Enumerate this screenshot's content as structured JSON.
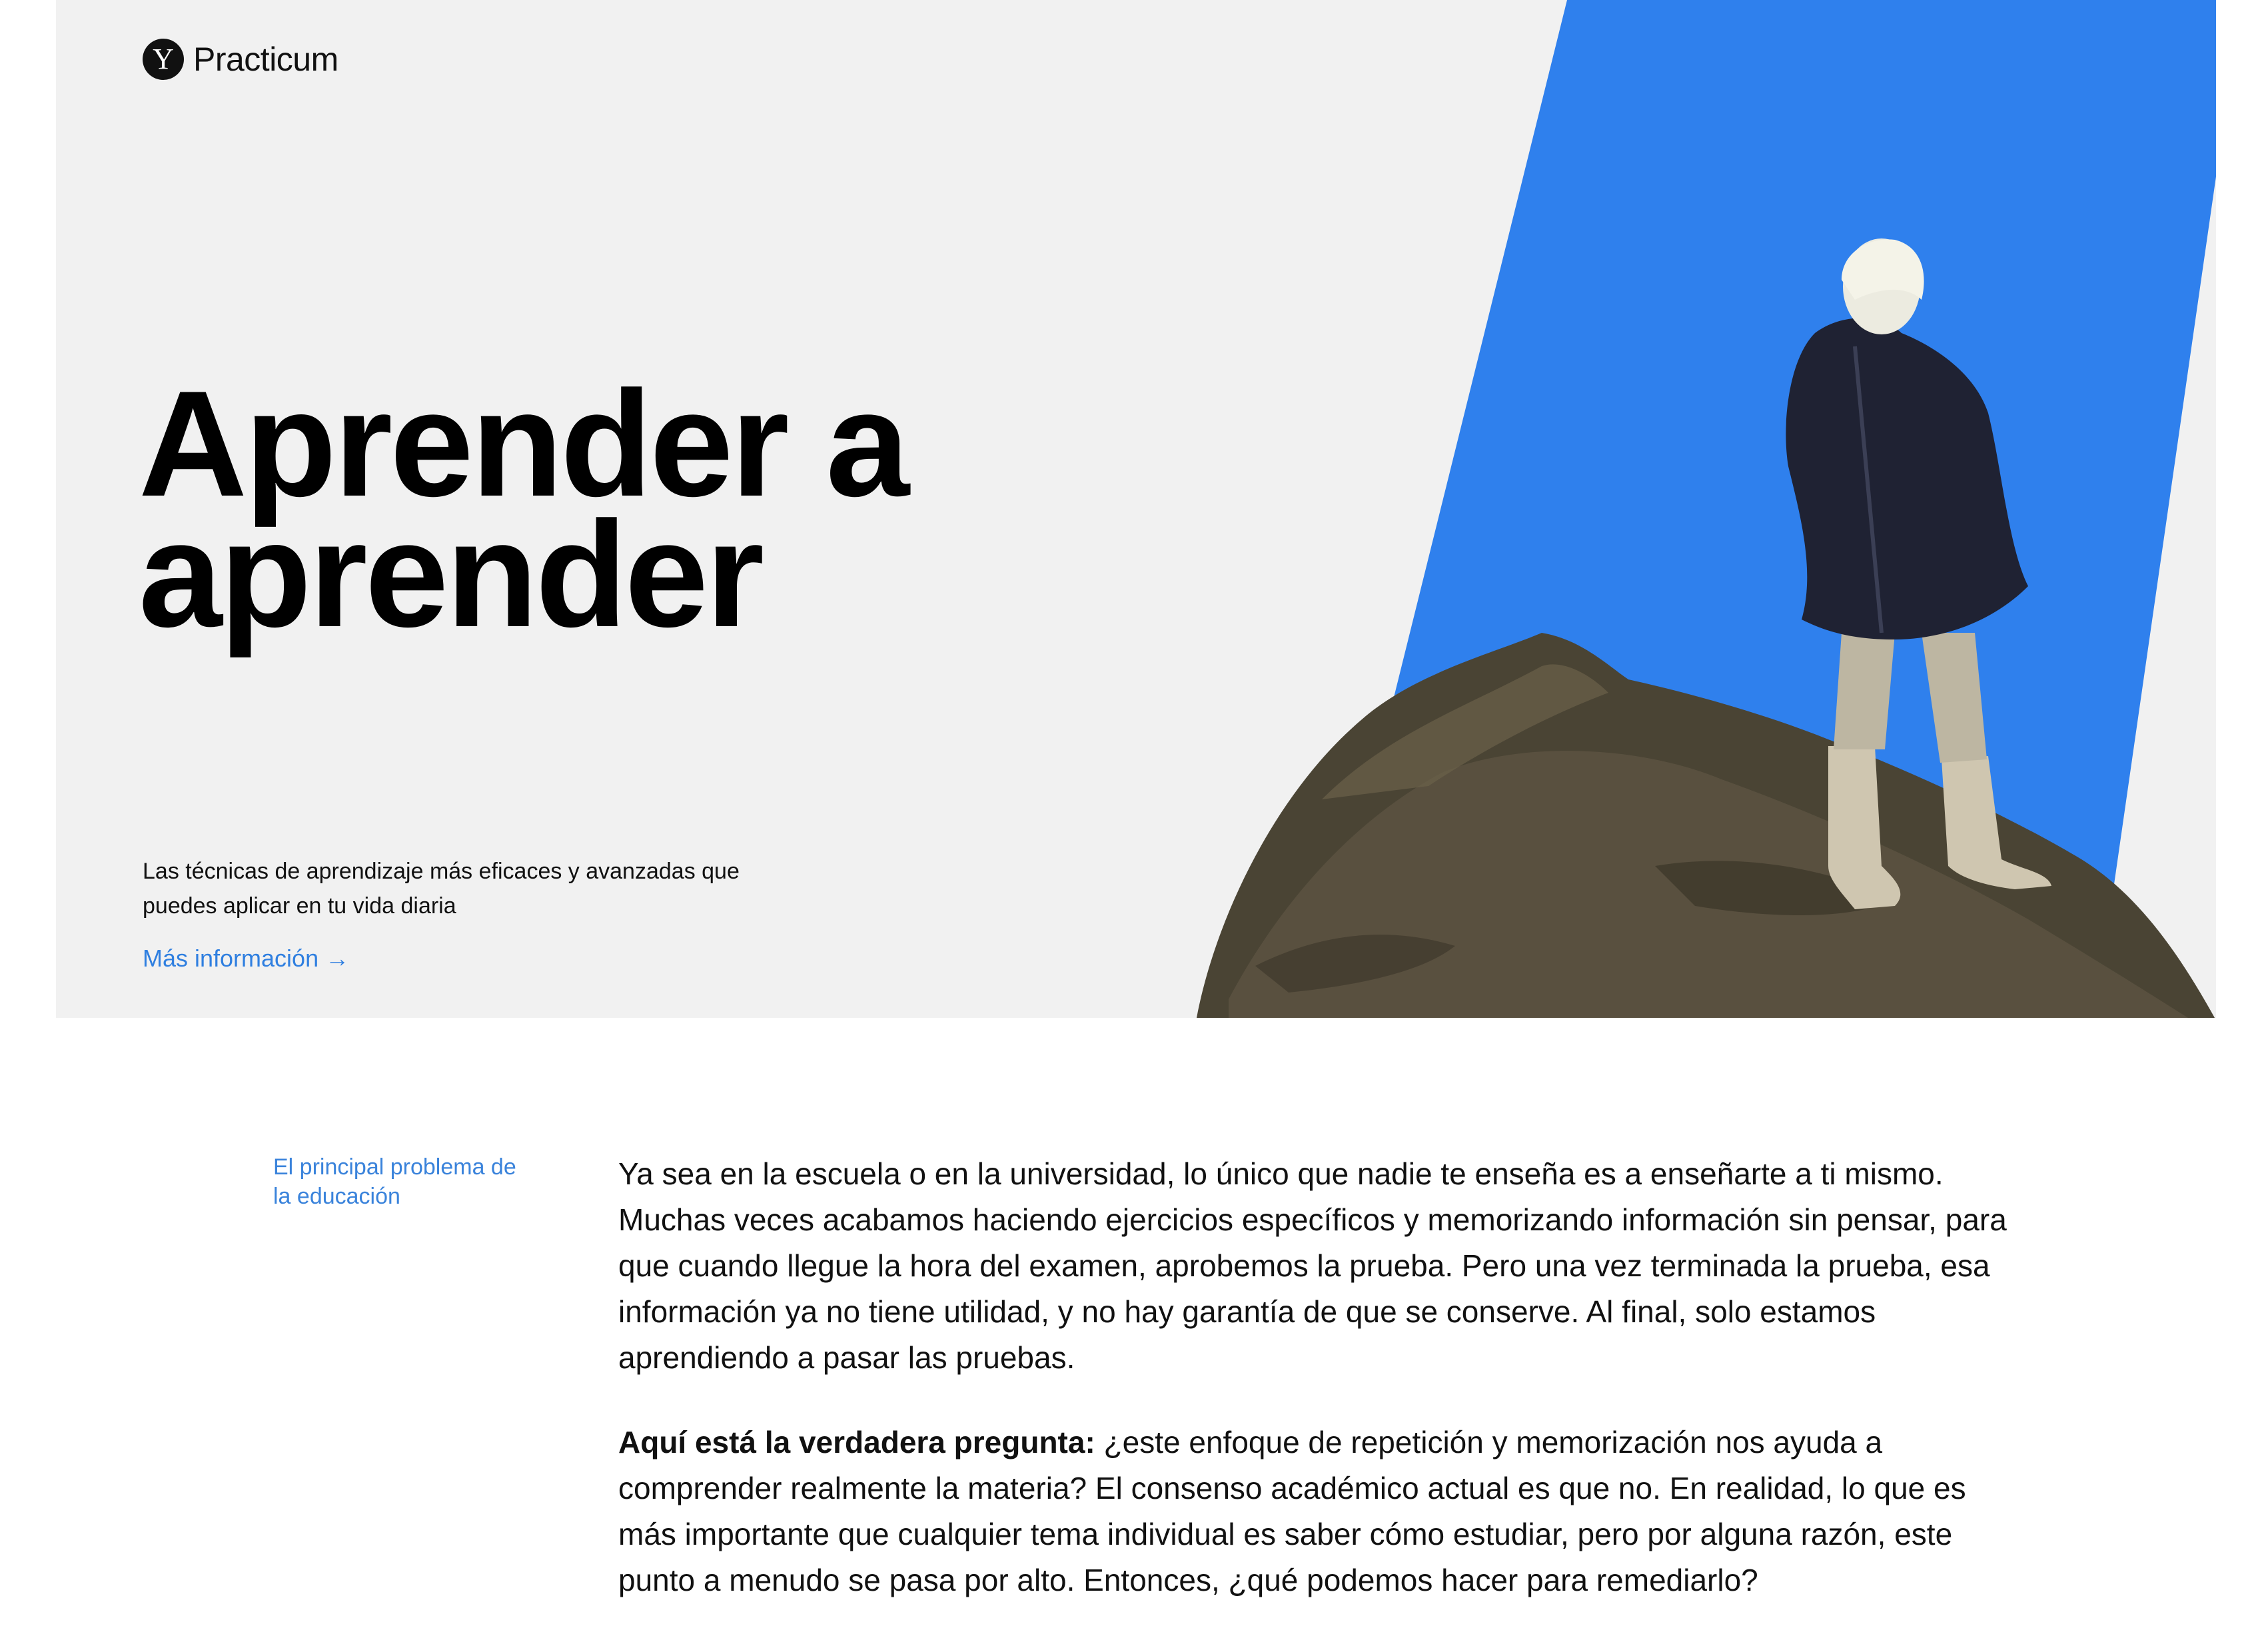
{
  "brand": {
    "logo_glyph": "Y",
    "name": "Practicum"
  },
  "hero": {
    "title": "Aprender a aprender",
    "subtitle": "Las técnicas de aprendizaje más eficaces y avanzadas que puedes aplicar en tu vida diaria",
    "link_label": "Más información →",
    "accent_color": "#2f80ed",
    "background_color": "#f1f1f1",
    "illustration": "person-in-coat-standing-on-rock"
  },
  "article": {
    "section_label": "El principal problema de la educación",
    "paragraph_1": "Ya sea en la escuela o en la universidad, lo único que nadie te enseña es a enseñarte a ti mismo. Muchas veces acabamos haciendo ejercicios específicos y memorizando información sin pensar, para que cuando llegue la hora del examen, aprobemos la prueba. Pero una vez terminada la prueba, esa información ya no tiene utilidad, y no hay garantía de que se conserve. Al final, solo estamos aprendiendo a pasar las pruebas.",
    "paragraph_2_bold": "Aquí está la verdadera pregunta:",
    "paragraph_2_rest": " ¿este enfoque de repetición y memorización nos ayuda a comprender realmente la materia? El consenso académico actual es que no. En realidad, lo que es más importante que cualquier tema individual es saber cómo estudiar, pero por alguna razón, este punto a menudo se pasa por alto. Entonces, ¿qué podemos hacer para remediarlo?",
    "link_color": "#3a83db"
  }
}
